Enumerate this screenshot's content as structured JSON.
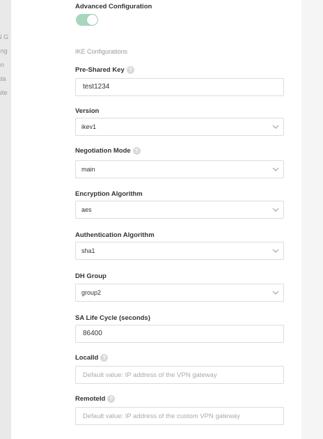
{
  "background": {
    "fragments": [
      "N G",
      "ting",
      "nn",
      "ata",
      "hite"
    ]
  },
  "advanced": {
    "label": "Advanced Configuration",
    "enabled": true
  },
  "section_title": "IKE Configurations",
  "fields": {
    "psk": {
      "label": "Pre-Shared Key",
      "value": "test1234"
    },
    "version": {
      "label": "Version",
      "value": "ikev1"
    },
    "negotiation": {
      "label": "Negotiation Mode",
      "value": "main"
    },
    "encryption": {
      "label": "Encryption Algorithm",
      "value": "aes"
    },
    "authentication": {
      "label": "Authentication Algorithm",
      "value": "sha1"
    },
    "dh": {
      "label": "DH Group",
      "value": "group2"
    },
    "sa_life": {
      "label": "SA Life Cycle (seconds)",
      "value": "86400"
    },
    "local_id": {
      "label": "LocalId",
      "placeholder": "Default value: IP address of the VPN gateway"
    },
    "remote_id": {
      "label": "RemoteId",
      "placeholder": "Default value: IP address of the custom VPN gateway"
    }
  },
  "icons": {
    "help": "question-circle-icon",
    "dropdown": "chevron-down-icon"
  },
  "colors": {
    "toggle_on": "#a7d6bd",
    "panel_bg": "#ffffff",
    "page_bg": "#f5f5f5"
  }
}
